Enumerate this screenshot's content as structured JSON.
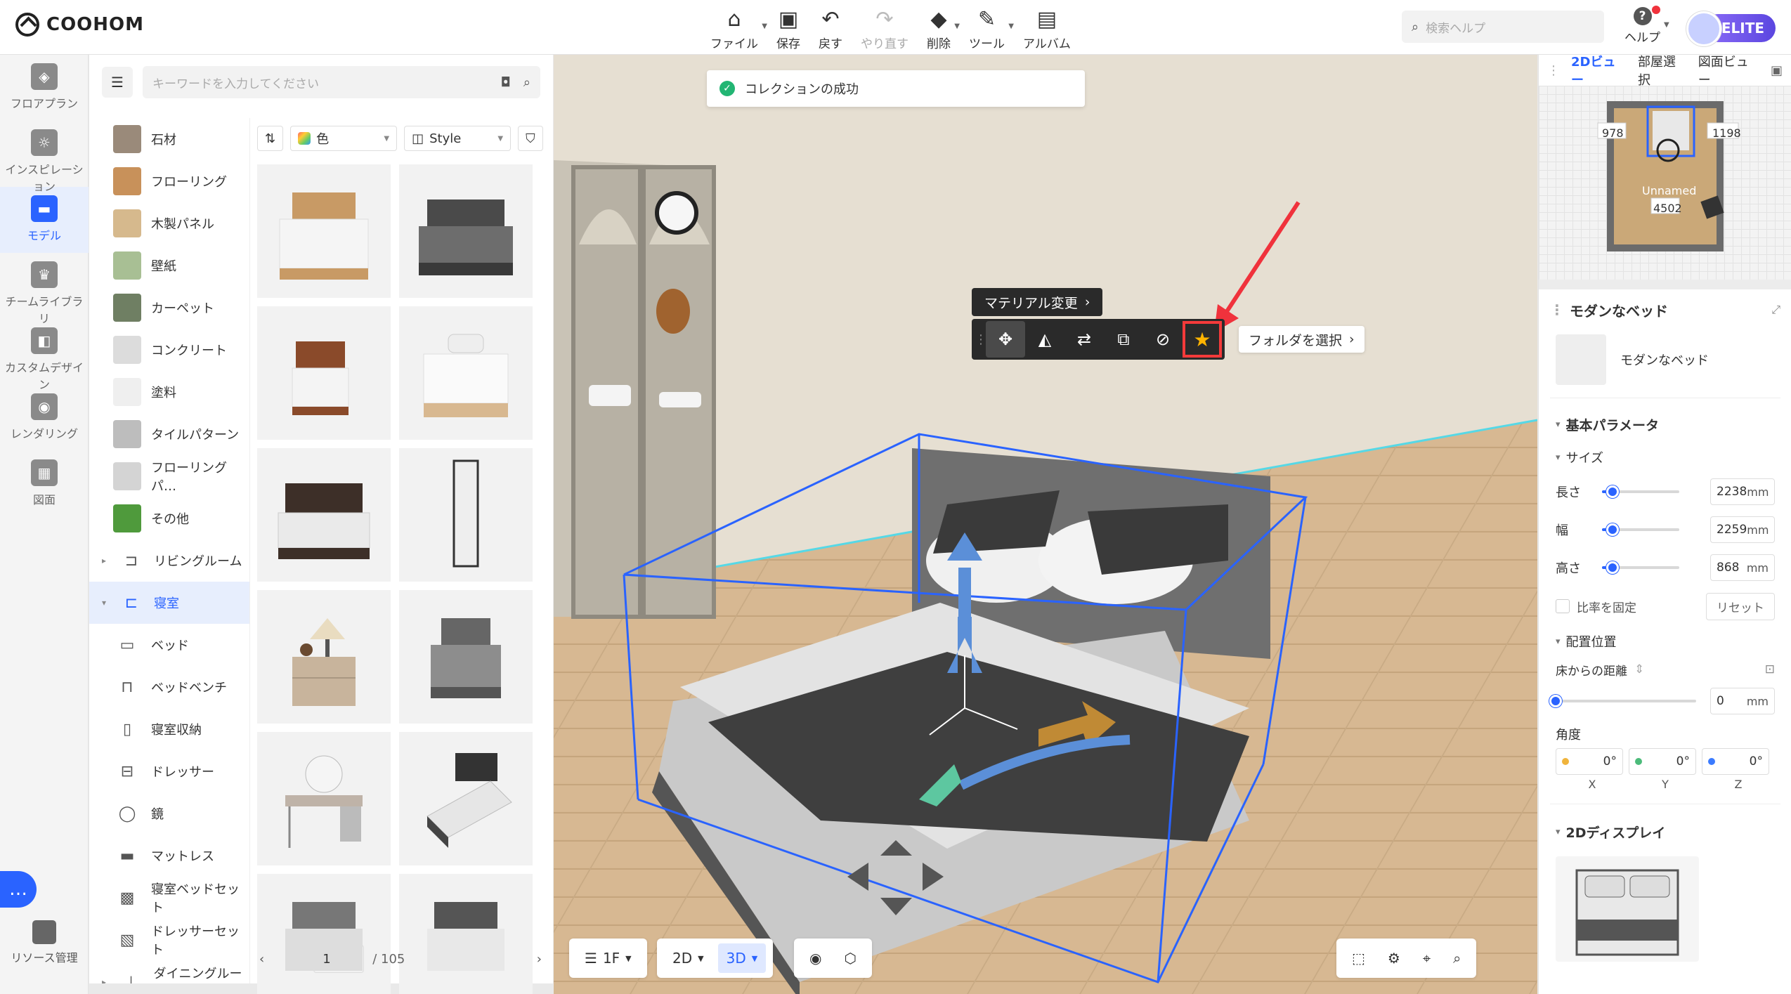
{
  "app": {
    "name": "COOHOM"
  },
  "toolbar": {
    "items": [
      {
        "label": "ファイル",
        "icon": "file-icon",
        "caret": true
      },
      {
        "label": "保存",
        "icon": "save-icon",
        "caret": false
      },
      {
        "label": "戻す",
        "icon": "undo-icon",
        "caret": false
      },
      {
        "label": "やり直す",
        "icon": "redo-icon",
        "caret": false,
        "disabled": true
      },
      {
        "label": "削除",
        "icon": "eraser-icon",
        "caret": true
      },
      {
        "label": "ツール",
        "icon": "wrench-icon",
        "caret": true
      },
      {
        "label": "アルバム",
        "icon": "album-icon",
        "caret": false
      }
    ],
    "search_placeholder": "検索ヘルプ",
    "help_label": "ヘルプ",
    "badge": "ELITE"
  },
  "leftnav": {
    "items": [
      {
        "label": "フロアプラン",
        "icon": "floorplan-icon"
      },
      {
        "label": "インスピレーション",
        "icon": "lightbulb-icon"
      },
      {
        "label": "モデル",
        "icon": "sofa-icon",
        "active": true
      },
      {
        "label": "チームライブラリ",
        "icon": "crown-icon"
      },
      {
        "label": "カスタムデザイン",
        "icon": "custom-icon"
      },
      {
        "label": "レンダリング",
        "icon": "camera-icon"
      },
      {
        "label": "図面",
        "icon": "drawing-icon"
      }
    ],
    "resource": "リソース管理"
  },
  "panel": {
    "search_placeholder": "キーワードを入力してください",
    "categories": [
      {
        "label": "石材",
        "swatch": "#9a8a7a"
      },
      {
        "label": "フローリング",
        "swatch": "#c8915a"
      },
      {
        "label": "木製パネル",
        "swatch": "#d6b98d"
      },
      {
        "label": "壁紙",
        "swatch": "#a8bf94"
      },
      {
        "label": "カーペット",
        "swatch": "#6f7f63"
      },
      {
        "label": "コンクリート",
        "swatch": "#dcdcdc"
      },
      {
        "label": "塗料",
        "swatch": "#efefef"
      },
      {
        "label": "タイルパターン",
        "swatch": "#bdbdbd"
      },
      {
        "label": "フローリングパ…",
        "swatch": "#d4d4d4"
      },
      {
        "label": "その他",
        "swatch": "#4f9a3c"
      }
    ],
    "groups": [
      {
        "label": "リビングルーム",
        "icon": "sofa-outline-icon"
      },
      {
        "label": "寝室",
        "icon": "bed-outline-icon",
        "active": true
      }
    ],
    "subcats": [
      {
        "label": "ベッド",
        "icon": "bed-icon"
      },
      {
        "label": "ベッドベンチ",
        "icon": "bench-icon"
      },
      {
        "label": "寝室収納",
        "icon": "storage-icon"
      },
      {
        "label": "ドレッサー",
        "icon": "dresser-icon"
      },
      {
        "label": "鏡",
        "icon": "mirror-icon"
      },
      {
        "label": "マットレス",
        "icon": "mattress-icon"
      },
      {
        "label": "寝室ベッドセット",
        "icon": "bedset-icon"
      },
      {
        "label": "ドレッサーセット",
        "icon": "dresserset-icon"
      }
    ],
    "group_next": "ダイニングルーム",
    "filter": {
      "color": "色",
      "style": "Style"
    },
    "pager": {
      "current": "1",
      "total": "/ 105"
    }
  },
  "viewport": {
    "toast": "コレクションの成功",
    "material_change": "マテリアル変更",
    "folder_select": "フォルダを選択",
    "floor": "1F",
    "view2d": "2D",
    "view3d": "3D"
  },
  "rightpanel": {
    "tabs": [
      "2Dビュー",
      "部屋選択",
      "図面ビュー"
    ],
    "minimap": {
      "dim_left": "978",
      "dim_right": "1198",
      "room_name": "Unnamed",
      "room_area": "4502"
    },
    "title": "モダンなベッド",
    "item_name": "モダンなベッド",
    "basic_params": "基本パラメータ",
    "size": "サイズ",
    "length": {
      "label": "長さ",
      "value": "2238",
      "unit": "mm",
      "level": 0.14
    },
    "width": {
      "label": "幅",
      "value": "2259",
      "unit": "mm",
      "level": 0.14
    },
    "height": {
      "label": "高さ",
      "value": "868",
      "unit": "mm",
      "level": 0.14
    },
    "lock_ratio": "比率を固定",
    "reset": "リセット",
    "position": "配置位置",
    "floor_distance": "床からの距離",
    "floor_value": "0",
    "floor_unit": "mm",
    "angle": "角度",
    "angles": [
      {
        "v": "0°",
        "c": "#f0b43c"
      },
      {
        "v": "0°",
        "c": "#4cbb7a"
      },
      {
        "v": "0°",
        "c": "#3b7bff"
      }
    ],
    "axes": [
      "X",
      "Y",
      "Z"
    ],
    "display2d": "2Dディスプレイ"
  }
}
